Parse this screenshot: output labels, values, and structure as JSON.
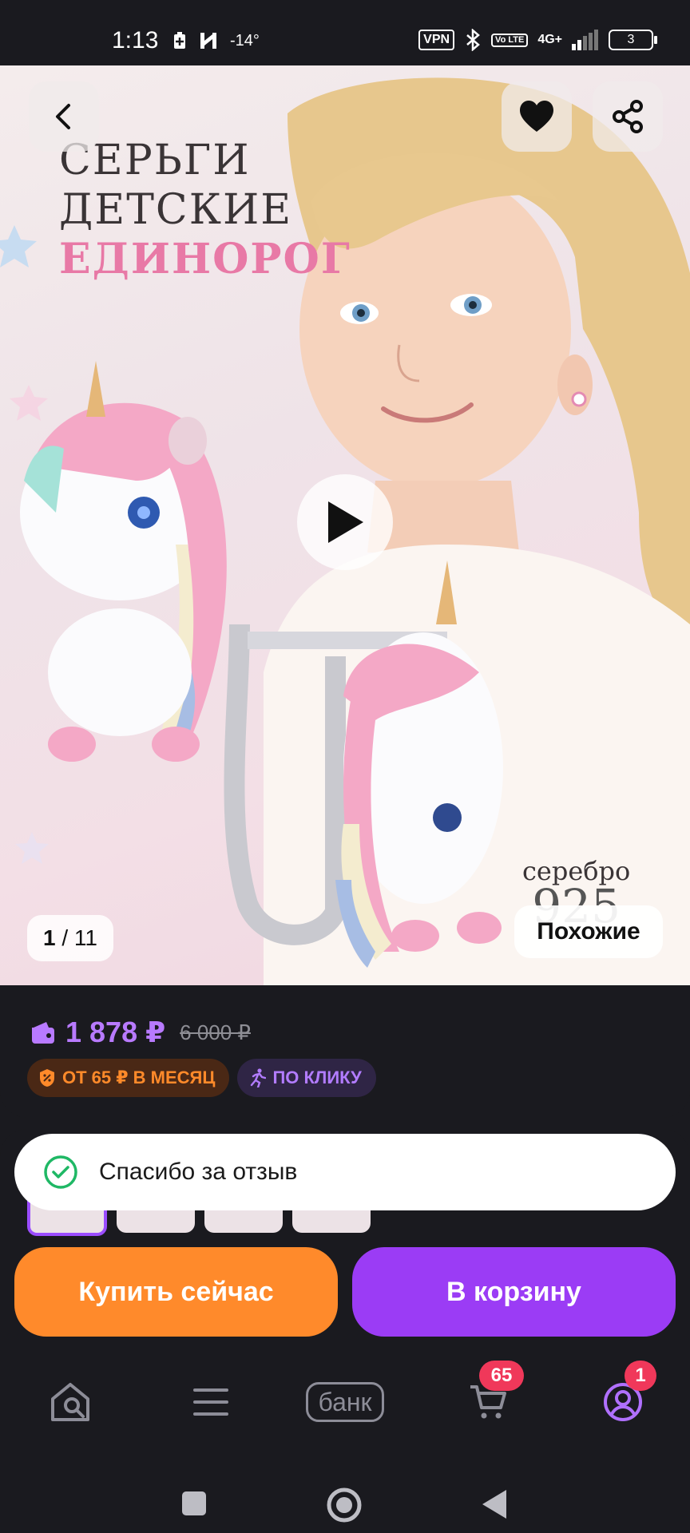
{
  "status_bar": {
    "time": "1:13",
    "temperature": "-14°",
    "vpn_label": "VPN",
    "volte_label": "Vo LTE",
    "network_label": "4G+",
    "battery": "3"
  },
  "gallery": {
    "promo_line1": "СЕРЬГИ",
    "promo_line2": "ДЕТСКИЕ",
    "promo_line3": "ЕДИНОРОГ",
    "material_word": "серебро",
    "material_number": "925",
    "counter_current": "1",
    "counter_total": "/ 11",
    "similar_label": "Похожие",
    "icons": [
      "back-icon",
      "heart-icon",
      "share-icon",
      "play-icon"
    ]
  },
  "price": {
    "current": "1 878 ₽",
    "old": "6 000 ₽",
    "installment_badge": "ОТ 65 ₽ В МЕСЯЦ",
    "click_badge": "ПО КЛИКУ",
    "accent": "#b87aff"
  },
  "toast": {
    "message": "Спасибо за отзыв"
  },
  "actions": {
    "buy_now": "Купить сейчас",
    "add_to_cart": "В корзину",
    "buy_color": "#ff8a2b",
    "cart_color": "#9b3cf5"
  },
  "bottom_nav": {
    "bank_label": "банк",
    "cart_count": "65",
    "profile_count": "1"
  }
}
